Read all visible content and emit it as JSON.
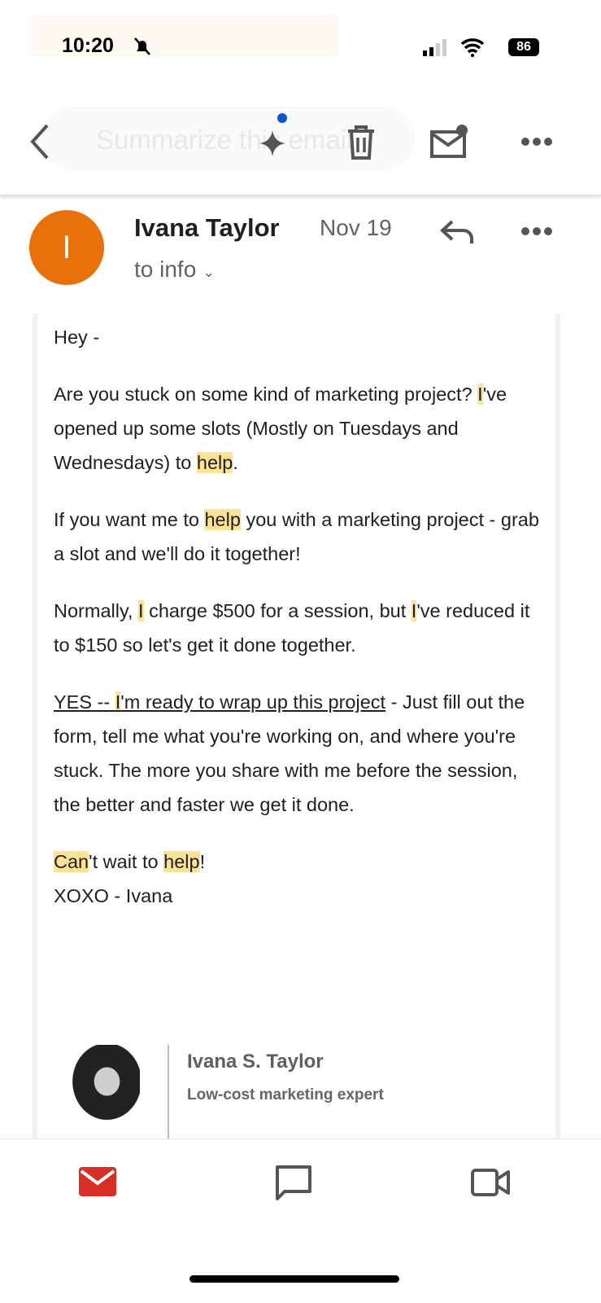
{
  "status": {
    "time": "10:20",
    "battery": "86"
  },
  "toolbar": {
    "summarize": "Summarize this email"
  },
  "email": {
    "avatar_letter": "I",
    "sender": "Ivana Taylor",
    "date": "Nov 19",
    "recipient": "to info",
    "paragraphs": [
      [
        {
          "t": "Hey -"
        }
      ],
      [
        {
          "t": "Are you stuck on some kind of marketing project? "
        },
        {
          "t": "I",
          "h": true
        },
        {
          "t": "'ve opened up some slots (Mostly on Tuesdays and Wednesdays) to "
        },
        {
          "t": "help",
          "h": true
        },
        {
          "t": "."
        }
      ],
      [
        {
          "t": "If you want me to "
        },
        {
          "t": "help",
          "h": true
        },
        {
          "t": " you with a marketing project - grab a slot and we'll do it together!"
        }
      ],
      [
        {
          "t": "Normally, "
        },
        {
          "t": "I",
          "h": true
        },
        {
          "t": " charge $500 for a session, but "
        },
        {
          "t": "I",
          "h": true
        },
        {
          "t": "'ve reduced it to $150 so let's get it done together."
        }
      ],
      [
        {
          "t": "YES -- ",
          "l": true
        },
        {
          "t": "I",
          "h": true,
          "l": true
        },
        {
          "t": "'m ready to wrap up this project",
          "l": true
        },
        {
          "t": " - Just fill out the form, tell me what you're working on, and where you're stuck.  The more you share with me before the session, the better and faster we get it done."
        }
      ],
      [
        {
          "t": "Can",
          "h": true
        },
        {
          "t": "'t wait to "
        },
        {
          "t": "help",
          "h": true
        },
        {
          "t": "!\nXOXO - Ivana"
        }
      ]
    ],
    "signature": {
      "name": "Ivana S. Taylor",
      "title": "Low-cost marketing expert"
    }
  },
  "colors": {
    "avatar": "#e8710a",
    "highlight": "#fde293",
    "mail_red": "#d93025",
    "gemini_dot": "#0b57d0"
  }
}
